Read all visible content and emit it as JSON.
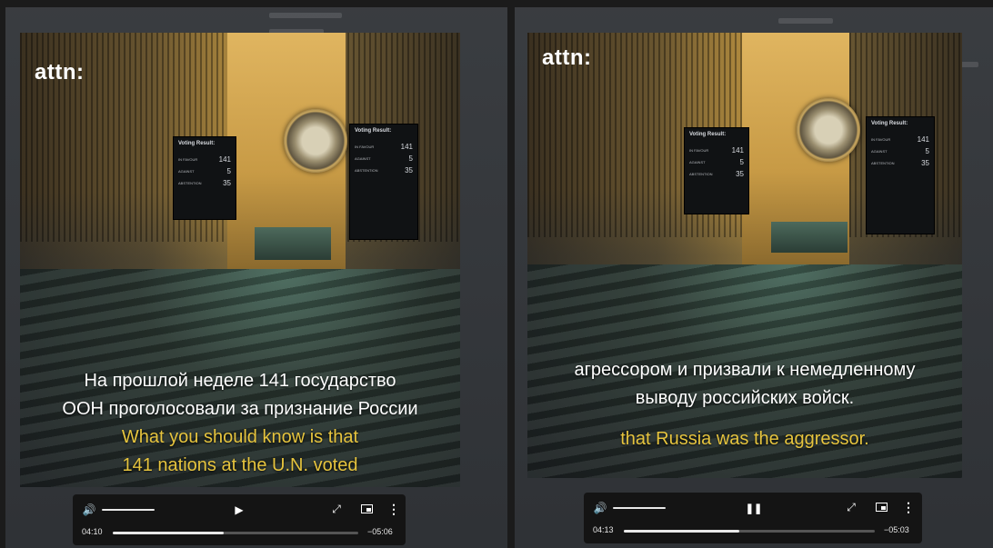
{
  "panels": [
    {
      "logo": "attn:",
      "board": {
        "title": "Voting Result:",
        "rows": [
          {
            "label": "IN FAVOUR",
            "value": "141"
          },
          {
            "label": "AGAINST",
            "value": "5"
          },
          {
            "label": "ABSTENTION",
            "value": "35"
          }
        ]
      },
      "caption_ru": [
        "На прошлой неделе 141 государство",
        "ООН проголосовали за признание России"
      ],
      "caption_en": [
        "What you should know is that",
        "141 nations at the U.N. voted"
      ],
      "controls": {
        "play_state": "paused",
        "play_icon": "play-icon",
        "elapsed": "04:10",
        "remaining": "−05:06",
        "progress": 0.45,
        "volume": 1.0
      }
    },
    {
      "logo": "attn:",
      "board": {
        "title": "Voting Result:",
        "rows": [
          {
            "label": "IN FAVOUR",
            "value": "141"
          },
          {
            "label": "AGAINST",
            "value": "5"
          },
          {
            "label": "ABSTENTION",
            "value": "35"
          }
        ]
      },
      "caption_ru": [
        "агрессором и призвали к немедленному",
        "выводу российских войск."
      ],
      "caption_en": [
        "that Russia was the aggressor."
      ],
      "controls": {
        "play_state": "playing",
        "play_icon": "pause-icon",
        "elapsed": "04:13",
        "remaining": "−05:03",
        "progress": 0.46,
        "volume": 1.0
      }
    }
  ]
}
